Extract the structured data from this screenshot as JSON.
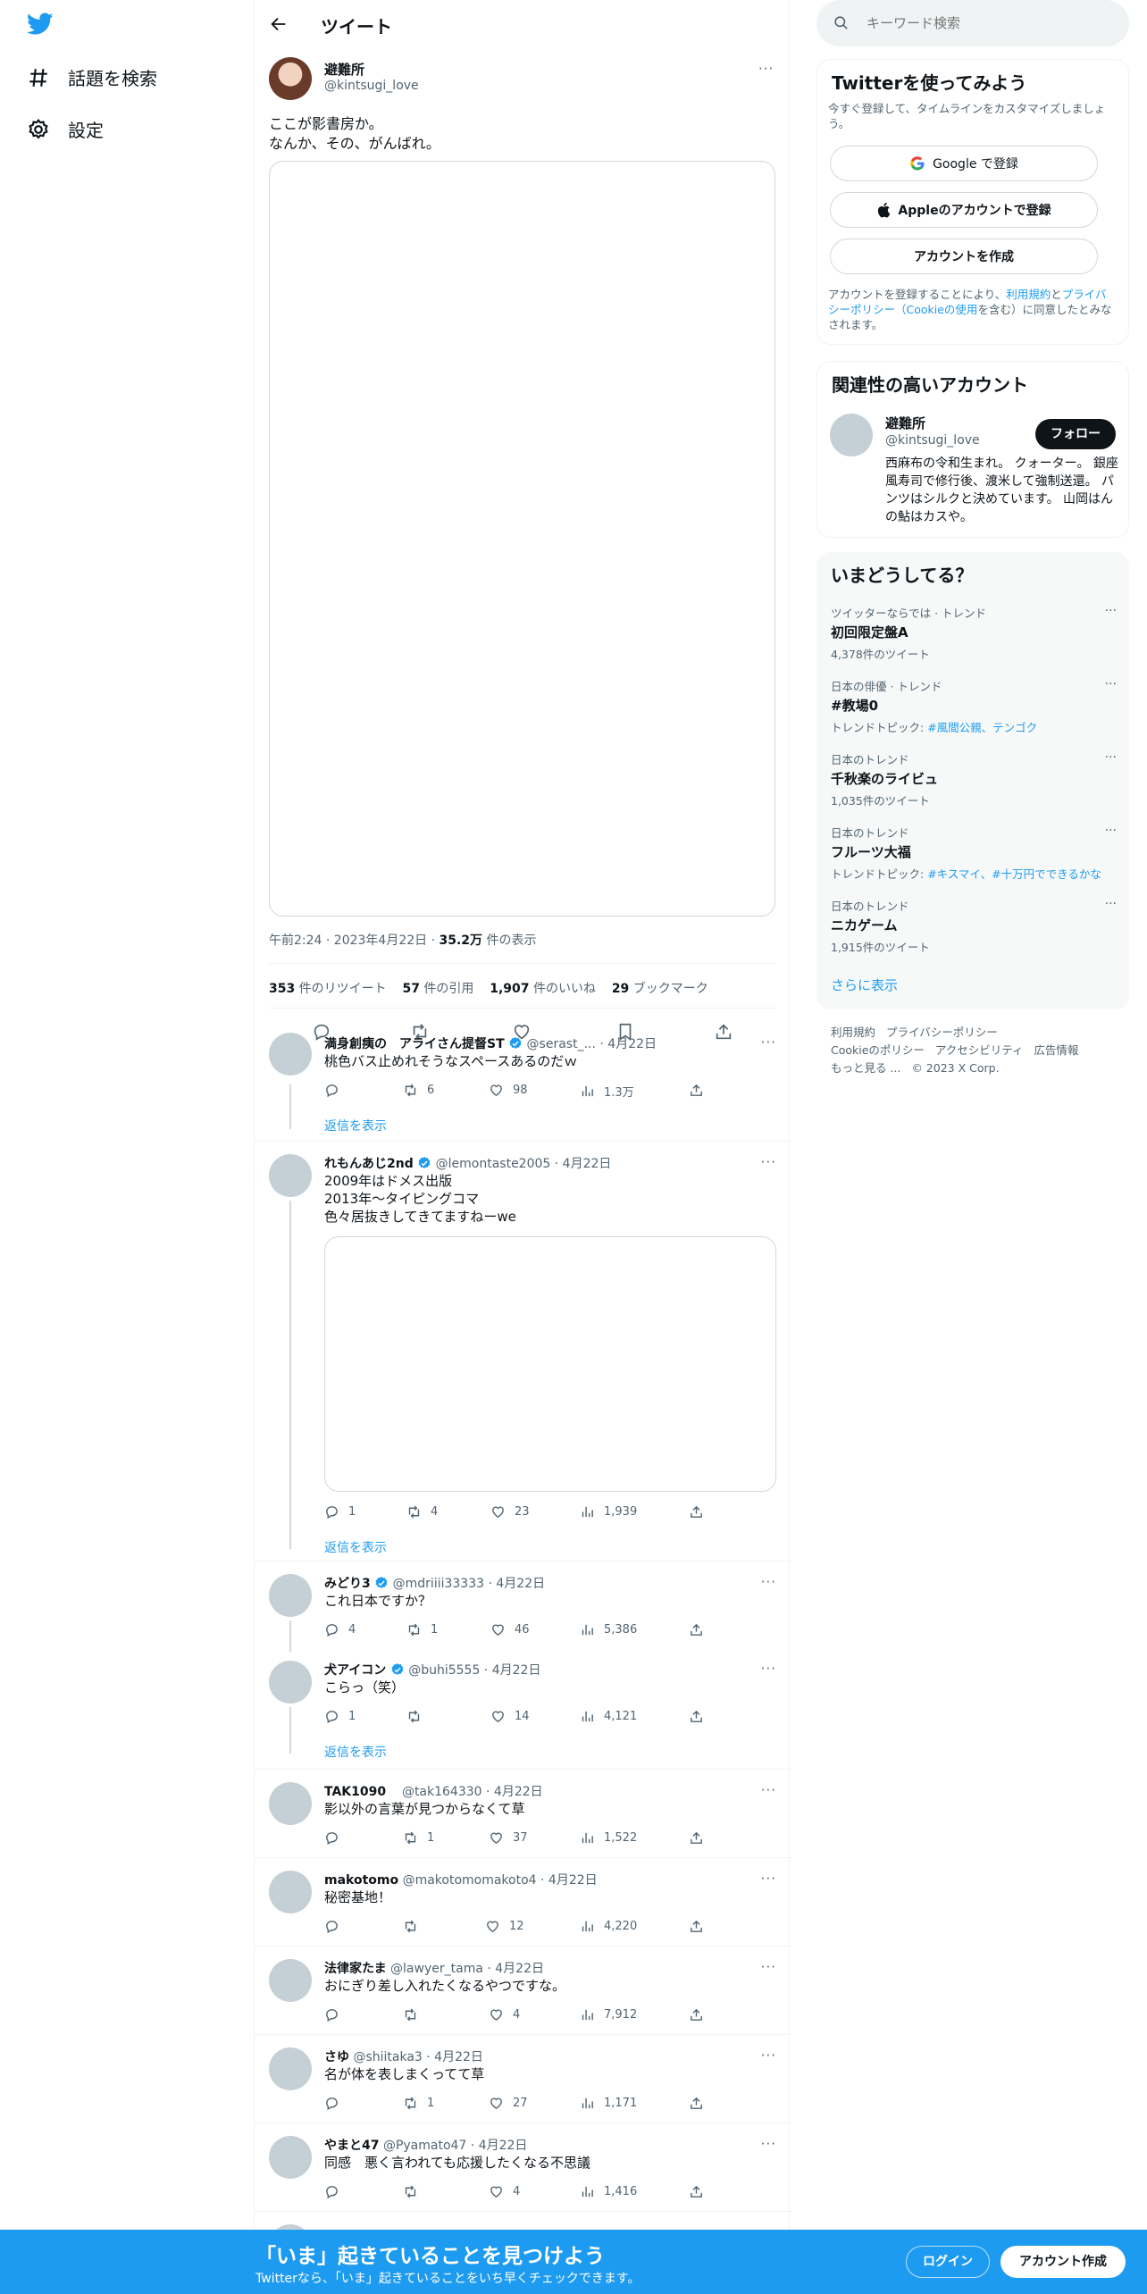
{
  "leftnav": {
    "items": [
      {
        "label": "話題を検索"
      },
      {
        "label": "設定"
      }
    ]
  },
  "header": {
    "title": "ツイート"
  },
  "tweet": {
    "name": "避難所",
    "handle": "@kintsugi_love",
    "text_line1": "ここが影書房か。",
    "text_line2": "なんか、その、がんばれ。",
    "time": "午前2:24 · 2023年4月22日 · ",
    "views_count": "35.2万",
    "views_label": " 件の表示",
    "retweets": "353",
    "retweets_label": " 件のリツイート",
    "quotes": "57",
    "quotes_label": " 件の引用",
    "likes": "1,907",
    "likes_label": " 件のいいね",
    "bookmarks": "29",
    "bookmarks_label": " ブックマーク"
  },
  "replies": [
    {
      "name": "満身創痍の　アライさん提督ST",
      "handle": "@serast_...",
      "date": "· 4月22日",
      "verified": true,
      "text": "桃色バス止めれそうなスペースあるのだｗ",
      "reply": "",
      "rt": "6",
      "like": "98",
      "views": "1.3万",
      "show_replies": "返信を表示"
    },
    {
      "name": "れもんあじ2nd",
      "handle": "@lemontaste2005",
      "date": "· 4月22日",
      "verified": true,
      "text1": "2009年はドメス出版",
      "text2": "2013年〜タイピングコマ",
      "text3": "色々居抜きしてきてますねーwe",
      "reply": "1",
      "rt": "4",
      "like": "23",
      "views": "1,939",
      "show_replies": "返信を表示"
    },
    {
      "name": "みどり3",
      "handle": "@mdriiii33333",
      "date": "· 4月22日",
      "verified": true,
      "text": "これ日本ですか？",
      "reply": "4",
      "rt": "1",
      "like": "46",
      "views": "5,386"
    },
    {
      "name": "犬アイコン",
      "handle": "@buhi5555",
      "date": "· 4月22日",
      "verified": true,
      "text": "こらっ（笑）",
      "reply": "1",
      "rt": "",
      "like": "14",
      "views": "4,121",
      "show_replies": "返信を表示"
    },
    {
      "name": "TAK1090",
      "handle": "@tak164330",
      "date": "· 4月22日",
      "text": "影以外の言葉が見つからなくて草",
      "reply": "",
      "rt": "1",
      "like": "37",
      "views": "1,522"
    },
    {
      "name": "makotomo",
      "handle": "@makotomomakoto4",
      "date": "· 4月22日",
      "text": "秘密基地！",
      "reply": "",
      "rt": "",
      "like": "12",
      "views": "4,220"
    },
    {
      "name": "法律家たま",
      "handle": "@lawyer_tama",
      "date": "· 4月22日",
      "text": "おにぎり差し入れたくなるやつですな。",
      "reply": "",
      "rt": "",
      "like": "4",
      "views": "7,912"
    },
    {
      "name": "さゆ",
      "handle": "@shiitaka3",
      "date": "· 4月22日",
      "text": "名が体を表しまくってて草",
      "reply": "",
      "rt": "1",
      "like": "27",
      "views": "1,171"
    },
    {
      "name": "やまと47",
      "handle": "@Pyamato47",
      "date": "· 4月22日",
      "text": "同感　悪く言われても応援したくなる不思議",
      "reply": "",
      "rt": "",
      "like": "4",
      "views": "1,416"
    }
  ],
  "search": {
    "placeholder": "キーワード検索"
  },
  "signup": {
    "title": "Twitterを使ってみよう",
    "subtitle": "今すぐ登録して、タイムラインをカスタマイズしましょう。",
    "google": "Google で登録",
    "apple": "Appleのアカウントで登録",
    "create": "アカウントを作成",
    "terms_1": "アカウントを登録することにより、",
    "terms_link1": "利用規約",
    "terms_2": "と",
    "terms_link2": "プライバシーポリシー（Cookieの使用",
    "terms_3": "を含む）に同意したとみなされます。"
  },
  "related": {
    "title": "関連性の高いアカウント",
    "name": "避難所",
    "handle": "@kintsugi_love",
    "follow": "フォロー",
    "bio": "西麻布の令和生まれ。 クォーター。 銀座風寿司で修行後、渡米して強制送還。 パンツはシルクと決めています。 山岡はんの鮎はカスや。"
  },
  "trends": {
    "title": "いまどうしてる？",
    "items": [
      {
        "context": "ツイッターならでは · トレンド",
        "name": "初回限定盤A",
        "meta": "4,378件のツイート"
      },
      {
        "context": "日本の俳優 · トレンド",
        "name": "#教場0",
        "meta_prefix": "トレンドトピック: ",
        "meta_links": "#風間公親、テンゴク"
      },
      {
        "context": "日本のトレンド",
        "name": "千秋楽のライビュ",
        "meta": "1,035件のツイート"
      },
      {
        "context": "日本のトレンド",
        "name": "フルーツ大福",
        "meta_prefix": "トレンドトピック: ",
        "meta_links": "#キスマイ、#十万円でできるかな"
      },
      {
        "context": "日本のトレンド",
        "name": "ニカゲーム",
        "meta": "1,915件のツイート"
      }
    ],
    "show_more": "さらに表示"
  },
  "footer": {
    "l1": "利用規約",
    "l2": "プライバシーポリシー",
    "l3": "Cookieのポリシー",
    "l4": "アクセシビリティ",
    "l5": "広告情報",
    "l6": "もっと見る ...",
    "copy": "© 2023 X Corp."
  },
  "bottombar": {
    "title": "「いま」起きていることを見つけよう",
    "subtitle": "Twitterなら、「いま」起きていることをいち早くチェックできます。",
    "login": "ログイン",
    "signup": "アカウント作成"
  },
  "colors": {
    "accent": "#1d9bf0",
    "text": "#0f1419",
    "muted": "#536471"
  }
}
